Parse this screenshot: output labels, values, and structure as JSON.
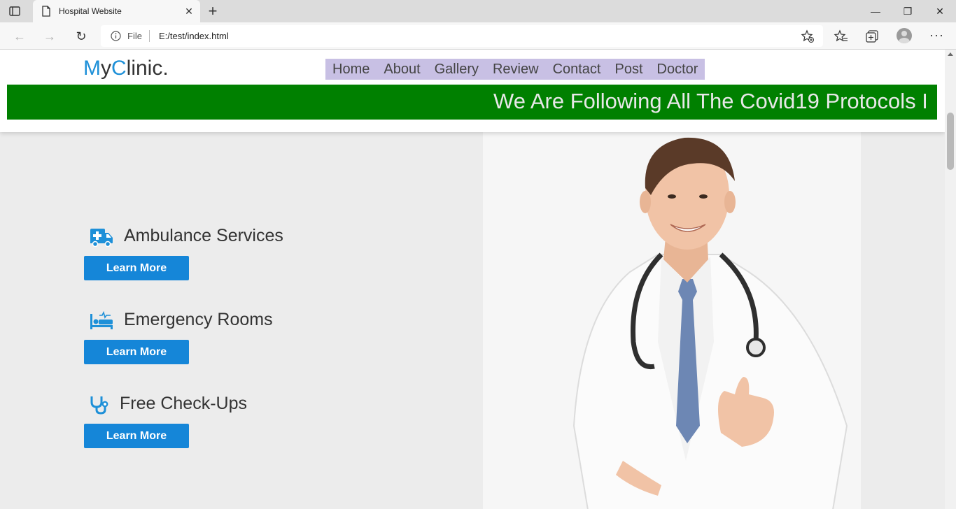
{
  "browser": {
    "tab_title": "Hospital Website",
    "url_scheme_label": "File",
    "url": "E:/test/index.html"
  },
  "site": {
    "logo_part1": "M",
    "logo_part2": "y",
    "logo_part3": "C",
    "logo_part4": "linic.",
    "nav": [
      "Home",
      "About",
      "Gallery",
      "Review",
      "Contact",
      "Post",
      "Doctor"
    ],
    "marquee": "We Are Following All The Covid19 Protocols I"
  },
  "services": [
    {
      "title": "Ambulance Services",
      "icon": "ambulance-icon",
      "button": "Learn More"
    },
    {
      "title": "Emergency Rooms",
      "icon": "procedures-icon",
      "button": "Learn More"
    },
    {
      "title": "Free Check-Ups",
      "icon": "stethoscope-icon",
      "button": "Learn More"
    }
  ],
  "colors": {
    "accent": "#1e90d8",
    "button": "#1586d8",
    "marquee_bg": "#008000",
    "nav_bg": "#c8c0e4"
  }
}
